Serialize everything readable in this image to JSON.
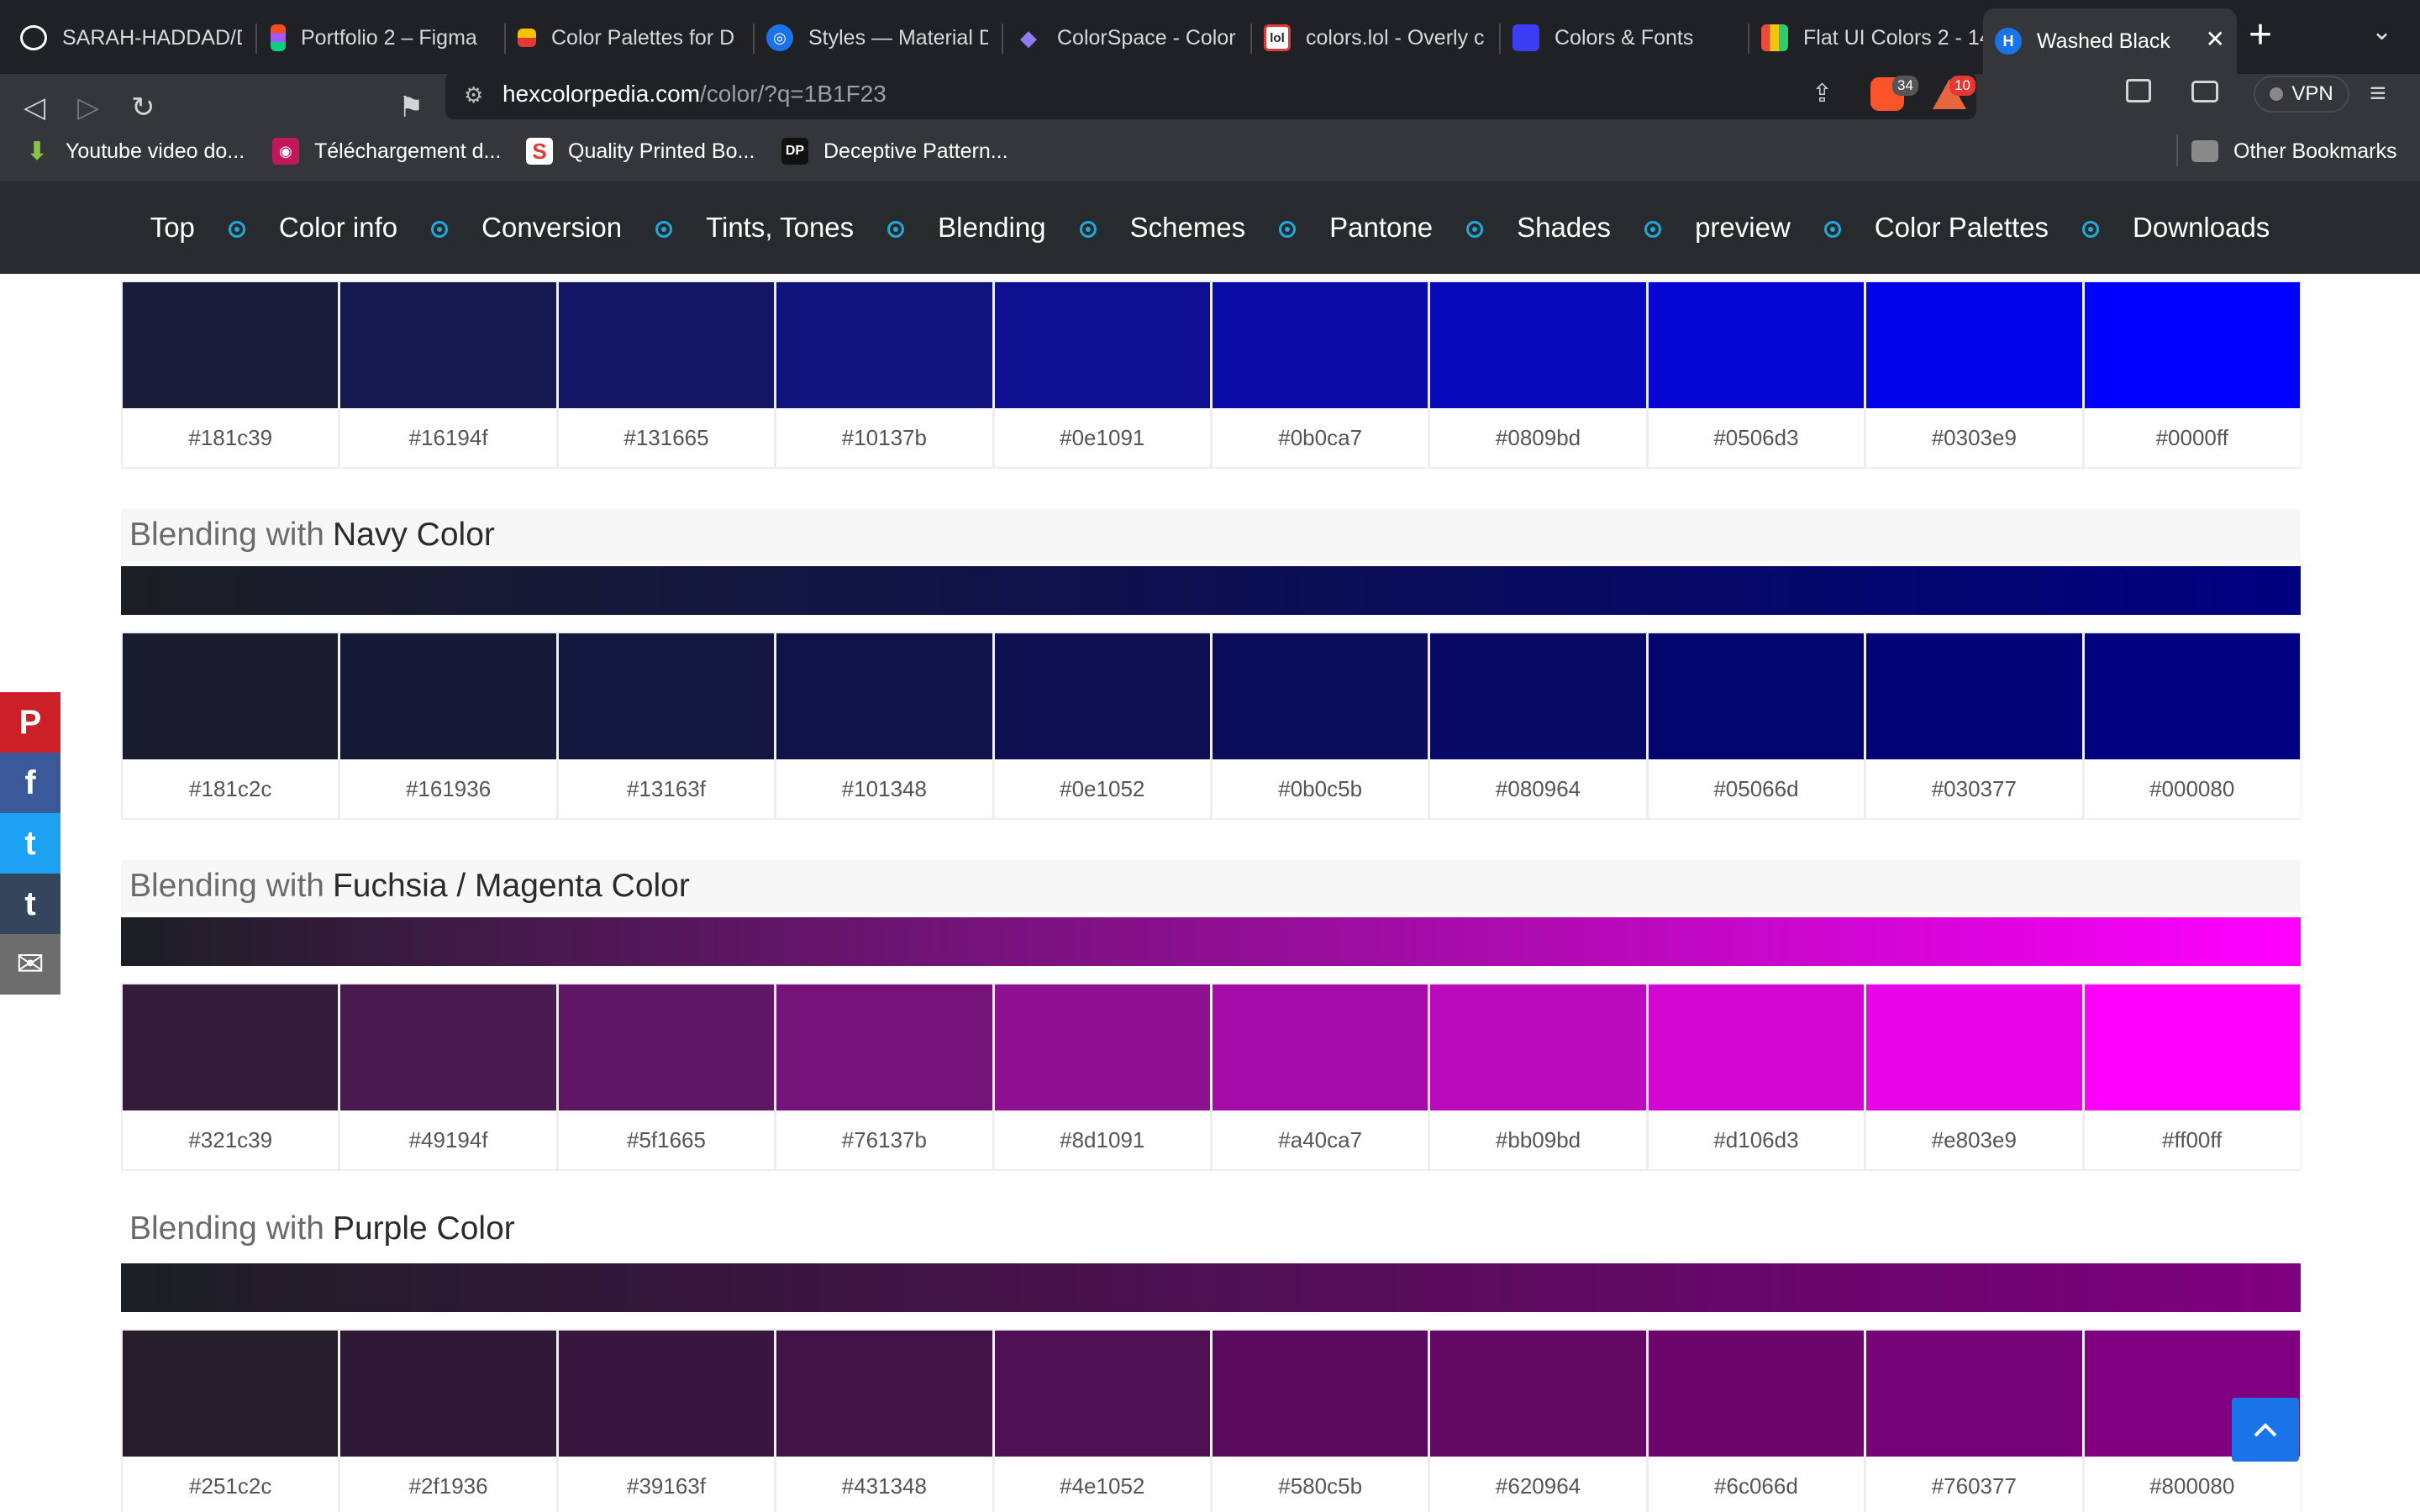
{
  "browser": {
    "tabs": [
      {
        "label": "SARAH-HADDAD/D",
        "icon": "github-icon"
      },
      {
        "label": "Portfolio 2 – Figma",
        "icon": "figma-icon"
      },
      {
        "label": "Color Palettes for D",
        "icon": "palette-icon"
      },
      {
        "label": "Styles — Material D",
        "icon": "material-icon"
      },
      {
        "label": "ColorSpace - Color",
        "icon": "colorspace-icon"
      },
      {
        "label": "colors.lol - Overly c",
        "icon": "lol-icon"
      },
      {
        "label": "Colors & Fonts",
        "icon": "colorsfonts-icon"
      },
      {
        "label": "Flat UI Colors 2 - 14",
        "icon": "flatui-icon"
      },
      {
        "label": "Washed Black",
        "icon": "hexcolorpedia-icon"
      }
    ],
    "url_host": "hexcolorpedia.com",
    "url_path": "/color/?q=1B1F23",
    "brave_count": "34",
    "alert_count": "10",
    "vpn_label": "VPN",
    "bookmarks": [
      {
        "label": "Youtube video do...",
        "icon": "download-icon"
      },
      {
        "label": "Téléchargement d...",
        "icon": "app-icon"
      },
      {
        "label": "Quality Printed Bo...",
        "icon": "s-icon"
      },
      {
        "label": "Deceptive Pattern...",
        "icon": "dp-icon"
      }
    ],
    "other_bookmarks": "Other Bookmarks"
  },
  "nav": {
    "items": [
      "Top",
      "Color info",
      "Conversion",
      "Tints, Tones",
      "Blending",
      "Schemes",
      "Pantone",
      "Shades",
      "preview",
      "Color Palettes",
      "Downloads"
    ],
    "accent": "#20a8d8"
  },
  "blends": [
    {
      "prefix": "",
      "name": "",
      "gradient": [
        "#1b1f23",
        "#0000ff"
      ],
      "swatches": [
        "#181c39",
        "#16194f",
        "#131665",
        "#10137b",
        "#0e1091",
        "#0b0ca7",
        "#0809bd",
        "#0506d3",
        "#0303e9",
        "#0000ff"
      ]
    },
    {
      "prefix": "Blending with",
      "name": "Navy Color",
      "gradient": [
        "#1b1f23",
        "#000080"
      ],
      "swatches": [
        "#181c2c",
        "#161936",
        "#13163f",
        "#101348",
        "#0e1052",
        "#0b0c5b",
        "#080964",
        "#05066d",
        "#030377",
        "#000080"
      ]
    },
    {
      "prefix": "Blending with",
      "name": "Fuchsia / Magenta Color",
      "gradient": [
        "#1b1f23",
        "#ff00ff"
      ],
      "swatches": [
        "#321c39",
        "#49194f",
        "#5f1665",
        "#76137b",
        "#8d1091",
        "#a40ca7",
        "#bb09bd",
        "#d106d3",
        "#e803e9",
        "#ff00ff"
      ]
    },
    {
      "prefix": "Blending with",
      "name": "Purple Color",
      "gradient": [
        "#1b1f23",
        "#800080"
      ],
      "swatches": [
        "#251c2c",
        "#2f1936",
        "#39163f",
        "#431348",
        "#4e1052",
        "#580c5b",
        "#620964",
        "#6c066d",
        "#760377",
        "#800080"
      ]
    }
  ],
  "social": [
    {
      "icon": "pinterest-icon",
      "glyph": "P",
      "color": "#cb2027"
    },
    {
      "icon": "facebook-icon",
      "glyph": "f",
      "color": "#3b5998"
    },
    {
      "icon": "twitter-icon",
      "glyph": "t",
      "color": "#1da1f2"
    },
    {
      "icon": "tumblr-icon",
      "glyph": "t",
      "color": "#35465c"
    },
    {
      "icon": "email-icon",
      "glyph": "✉",
      "color": "#6d6d6d"
    }
  ]
}
